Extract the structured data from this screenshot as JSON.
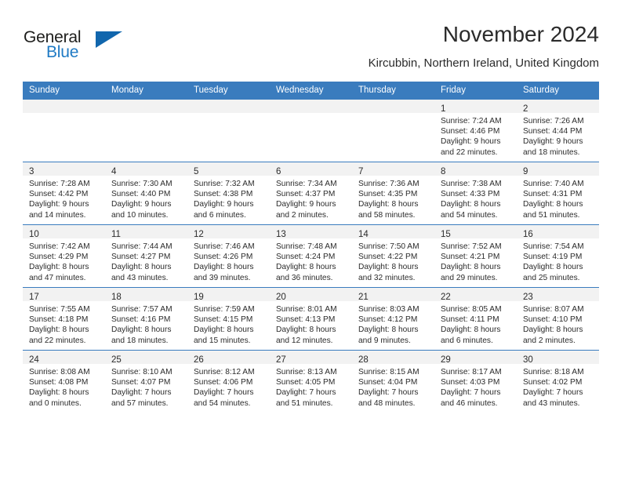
{
  "brand": {
    "logo_primary": "General",
    "logo_secondary": "Blue",
    "accent_color": "#1166ad",
    "header_color": "#3a7cbe"
  },
  "header": {
    "title": "November 2024",
    "subtitle": "Kircubbin, Northern Ireland, United Kingdom"
  },
  "calendar": {
    "weekday_headers": [
      "Sunday",
      "Monday",
      "Tuesday",
      "Wednesday",
      "Thursday",
      "Friday",
      "Saturday"
    ],
    "weeks": [
      [
        {
          "day": "",
          "lines": []
        },
        {
          "day": "",
          "lines": []
        },
        {
          "day": "",
          "lines": []
        },
        {
          "day": "",
          "lines": []
        },
        {
          "day": "",
          "lines": []
        },
        {
          "day": "1",
          "lines": [
            "Sunrise: 7:24 AM",
            "Sunset: 4:46 PM",
            "Daylight: 9 hours",
            "and 22 minutes."
          ]
        },
        {
          "day": "2",
          "lines": [
            "Sunrise: 7:26 AM",
            "Sunset: 4:44 PM",
            "Daylight: 9 hours",
            "and 18 minutes."
          ]
        }
      ],
      [
        {
          "day": "3",
          "lines": [
            "Sunrise: 7:28 AM",
            "Sunset: 4:42 PM",
            "Daylight: 9 hours",
            "and 14 minutes."
          ]
        },
        {
          "day": "4",
          "lines": [
            "Sunrise: 7:30 AM",
            "Sunset: 4:40 PM",
            "Daylight: 9 hours",
            "and 10 minutes."
          ]
        },
        {
          "day": "5",
          "lines": [
            "Sunrise: 7:32 AM",
            "Sunset: 4:38 PM",
            "Daylight: 9 hours",
            "and 6 minutes."
          ]
        },
        {
          "day": "6",
          "lines": [
            "Sunrise: 7:34 AM",
            "Sunset: 4:37 PM",
            "Daylight: 9 hours",
            "and 2 minutes."
          ]
        },
        {
          "day": "7",
          "lines": [
            "Sunrise: 7:36 AM",
            "Sunset: 4:35 PM",
            "Daylight: 8 hours",
            "and 58 minutes."
          ]
        },
        {
          "day": "8",
          "lines": [
            "Sunrise: 7:38 AM",
            "Sunset: 4:33 PM",
            "Daylight: 8 hours",
            "and 54 minutes."
          ]
        },
        {
          "day": "9",
          "lines": [
            "Sunrise: 7:40 AM",
            "Sunset: 4:31 PM",
            "Daylight: 8 hours",
            "and 51 minutes."
          ]
        }
      ],
      [
        {
          "day": "10",
          "lines": [
            "Sunrise: 7:42 AM",
            "Sunset: 4:29 PM",
            "Daylight: 8 hours",
            "and 47 minutes."
          ]
        },
        {
          "day": "11",
          "lines": [
            "Sunrise: 7:44 AM",
            "Sunset: 4:27 PM",
            "Daylight: 8 hours",
            "and 43 minutes."
          ]
        },
        {
          "day": "12",
          "lines": [
            "Sunrise: 7:46 AM",
            "Sunset: 4:26 PM",
            "Daylight: 8 hours",
            "and 39 minutes."
          ]
        },
        {
          "day": "13",
          "lines": [
            "Sunrise: 7:48 AM",
            "Sunset: 4:24 PM",
            "Daylight: 8 hours",
            "and 36 minutes."
          ]
        },
        {
          "day": "14",
          "lines": [
            "Sunrise: 7:50 AM",
            "Sunset: 4:22 PM",
            "Daylight: 8 hours",
            "and 32 minutes."
          ]
        },
        {
          "day": "15",
          "lines": [
            "Sunrise: 7:52 AM",
            "Sunset: 4:21 PM",
            "Daylight: 8 hours",
            "and 29 minutes."
          ]
        },
        {
          "day": "16",
          "lines": [
            "Sunrise: 7:54 AM",
            "Sunset: 4:19 PM",
            "Daylight: 8 hours",
            "and 25 minutes."
          ]
        }
      ],
      [
        {
          "day": "17",
          "lines": [
            "Sunrise: 7:55 AM",
            "Sunset: 4:18 PM",
            "Daylight: 8 hours",
            "and 22 minutes."
          ]
        },
        {
          "day": "18",
          "lines": [
            "Sunrise: 7:57 AM",
            "Sunset: 4:16 PM",
            "Daylight: 8 hours",
            "and 18 minutes."
          ]
        },
        {
          "day": "19",
          "lines": [
            "Sunrise: 7:59 AM",
            "Sunset: 4:15 PM",
            "Daylight: 8 hours",
            "and 15 minutes."
          ]
        },
        {
          "day": "20",
          "lines": [
            "Sunrise: 8:01 AM",
            "Sunset: 4:13 PM",
            "Daylight: 8 hours",
            "and 12 minutes."
          ]
        },
        {
          "day": "21",
          "lines": [
            "Sunrise: 8:03 AM",
            "Sunset: 4:12 PM",
            "Daylight: 8 hours",
            "and 9 minutes."
          ]
        },
        {
          "day": "22",
          "lines": [
            "Sunrise: 8:05 AM",
            "Sunset: 4:11 PM",
            "Daylight: 8 hours",
            "and 6 minutes."
          ]
        },
        {
          "day": "23",
          "lines": [
            "Sunrise: 8:07 AM",
            "Sunset: 4:10 PM",
            "Daylight: 8 hours",
            "and 2 minutes."
          ]
        }
      ],
      [
        {
          "day": "24",
          "lines": [
            "Sunrise: 8:08 AM",
            "Sunset: 4:08 PM",
            "Daylight: 8 hours",
            "and 0 minutes."
          ]
        },
        {
          "day": "25",
          "lines": [
            "Sunrise: 8:10 AM",
            "Sunset: 4:07 PM",
            "Daylight: 7 hours",
            "and 57 minutes."
          ]
        },
        {
          "day": "26",
          "lines": [
            "Sunrise: 8:12 AM",
            "Sunset: 4:06 PM",
            "Daylight: 7 hours",
            "and 54 minutes."
          ]
        },
        {
          "day": "27",
          "lines": [
            "Sunrise: 8:13 AM",
            "Sunset: 4:05 PM",
            "Daylight: 7 hours",
            "and 51 minutes."
          ]
        },
        {
          "day": "28",
          "lines": [
            "Sunrise: 8:15 AM",
            "Sunset: 4:04 PM",
            "Daylight: 7 hours",
            "and 48 minutes."
          ]
        },
        {
          "day": "29",
          "lines": [
            "Sunrise: 8:17 AM",
            "Sunset: 4:03 PM",
            "Daylight: 7 hours",
            "and 46 minutes."
          ]
        },
        {
          "day": "30",
          "lines": [
            "Sunrise: 8:18 AM",
            "Sunset: 4:02 PM",
            "Daylight: 7 hours",
            "and 43 minutes."
          ]
        }
      ]
    ]
  }
}
